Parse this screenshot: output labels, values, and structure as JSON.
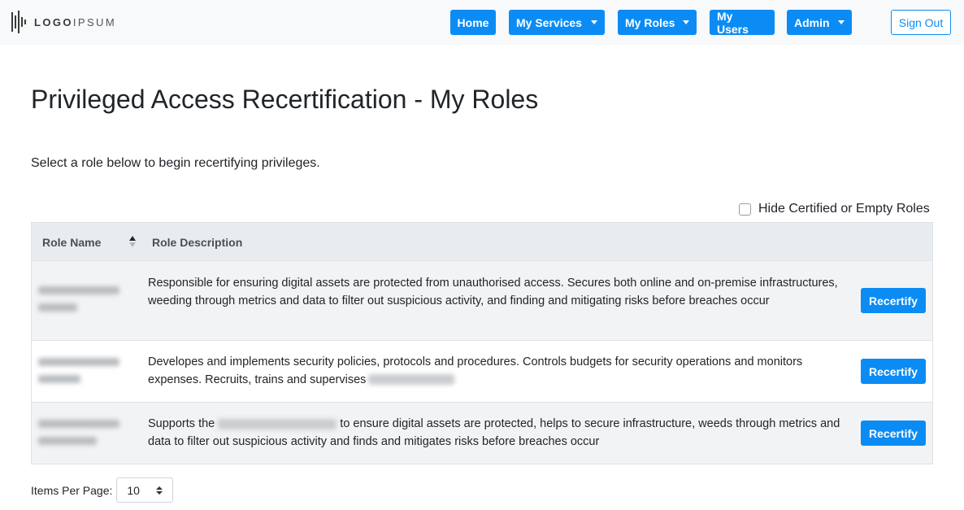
{
  "brand": {
    "logo_text_bold": "LOGO",
    "logo_text_thin": "IPSUM",
    "icon": "soundwave-logo-icon"
  },
  "nav": {
    "home": "Home",
    "my_services": "My Services",
    "my_roles": "My Roles",
    "my_users": "My Users",
    "admin": "Admin",
    "sign_out": "Sign Out"
  },
  "colors": {
    "primary": "#0b8cf5",
    "navbar_bg": "#f8f9fa",
    "table_header_bg": "#e9ecef",
    "stripe_bg": "#f2f3f4"
  },
  "page": {
    "title": "Privileged Access Recertification - My Roles",
    "intro": "Select a role below to begin recertifying privileges.",
    "hide_toggle_label": "Hide Certified or Empty Roles",
    "hide_toggle_checked": false
  },
  "table": {
    "columns": [
      "Role Name",
      "Role Description"
    ],
    "sort_icon": "sort-ascending-icon",
    "rows": [
      {
        "description": "Responsible for ensuring digital assets are protected from unauthorised access. Secures both online and on-premise infrastructures, weeding through metrics and data to filter out suspicious activity, and finding and mitigating risks before breaches occur",
        "action": "Recertify"
      },
      {
        "description": "Developes and implements security policies, protocols and procedures. Controls budgets for security operations and monitors expenses. Recruits, trains and supervises",
        "action": "Recertify"
      },
      {
        "description_before": "Supports the",
        "description_after": "to ensure digital assets are protected, helps to secure infrastructure, weeds through metrics and data to filter out suspicious activity and finds and mitigates risks before breaches occur",
        "action": "Recertify"
      }
    ]
  },
  "pagination": {
    "label": "Items Per Page:",
    "selected": "10"
  }
}
